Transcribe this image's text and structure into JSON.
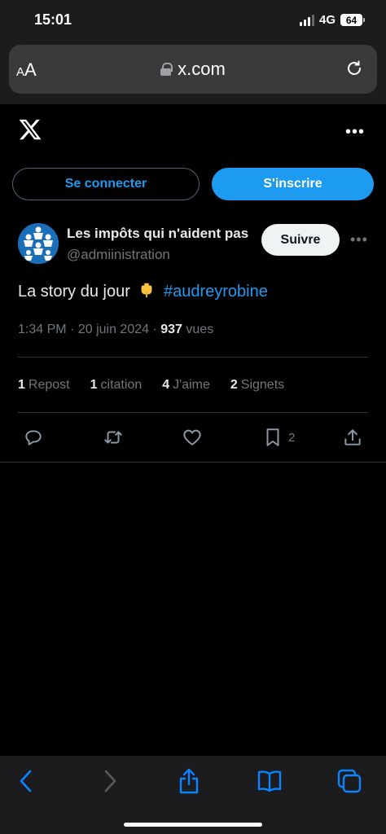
{
  "status_bar": {
    "time": "15:01",
    "network": "4G",
    "battery": "64"
  },
  "browser": {
    "aa_label_small": "A",
    "aa_label_large": "A",
    "url": "x.com"
  },
  "header": {
    "more_label": "•••"
  },
  "auth": {
    "login_label": "Se connecter",
    "signup_label": "S'inscrire"
  },
  "tweet": {
    "display_name": "Les impôts qui n'aident pas",
    "handle": "@admiinistration",
    "follow_label": "Suivre",
    "more_label": "•••",
    "text_prefix": "La story du jour",
    "emoji": "backhand-index-pointing-down",
    "hashtag": "#audreyrobine",
    "time": "1:34 PM",
    "separator": "·",
    "date": "20 juin 2024",
    "views_count": "937",
    "views_label": "vues",
    "stats": [
      {
        "count": "1",
        "label": "Repost"
      },
      {
        "count": "1",
        "label": "citation"
      },
      {
        "count": "4",
        "label": "J'aime"
      },
      {
        "count": "2",
        "label": "Signets"
      }
    ],
    "bookmark_count": "2"
  },
  "colors": {
    "accent": "#1d9bf0",
    "background": "#000000",
    "muted": "#71767b",
    "divider": "#2f3336"
  }
}
